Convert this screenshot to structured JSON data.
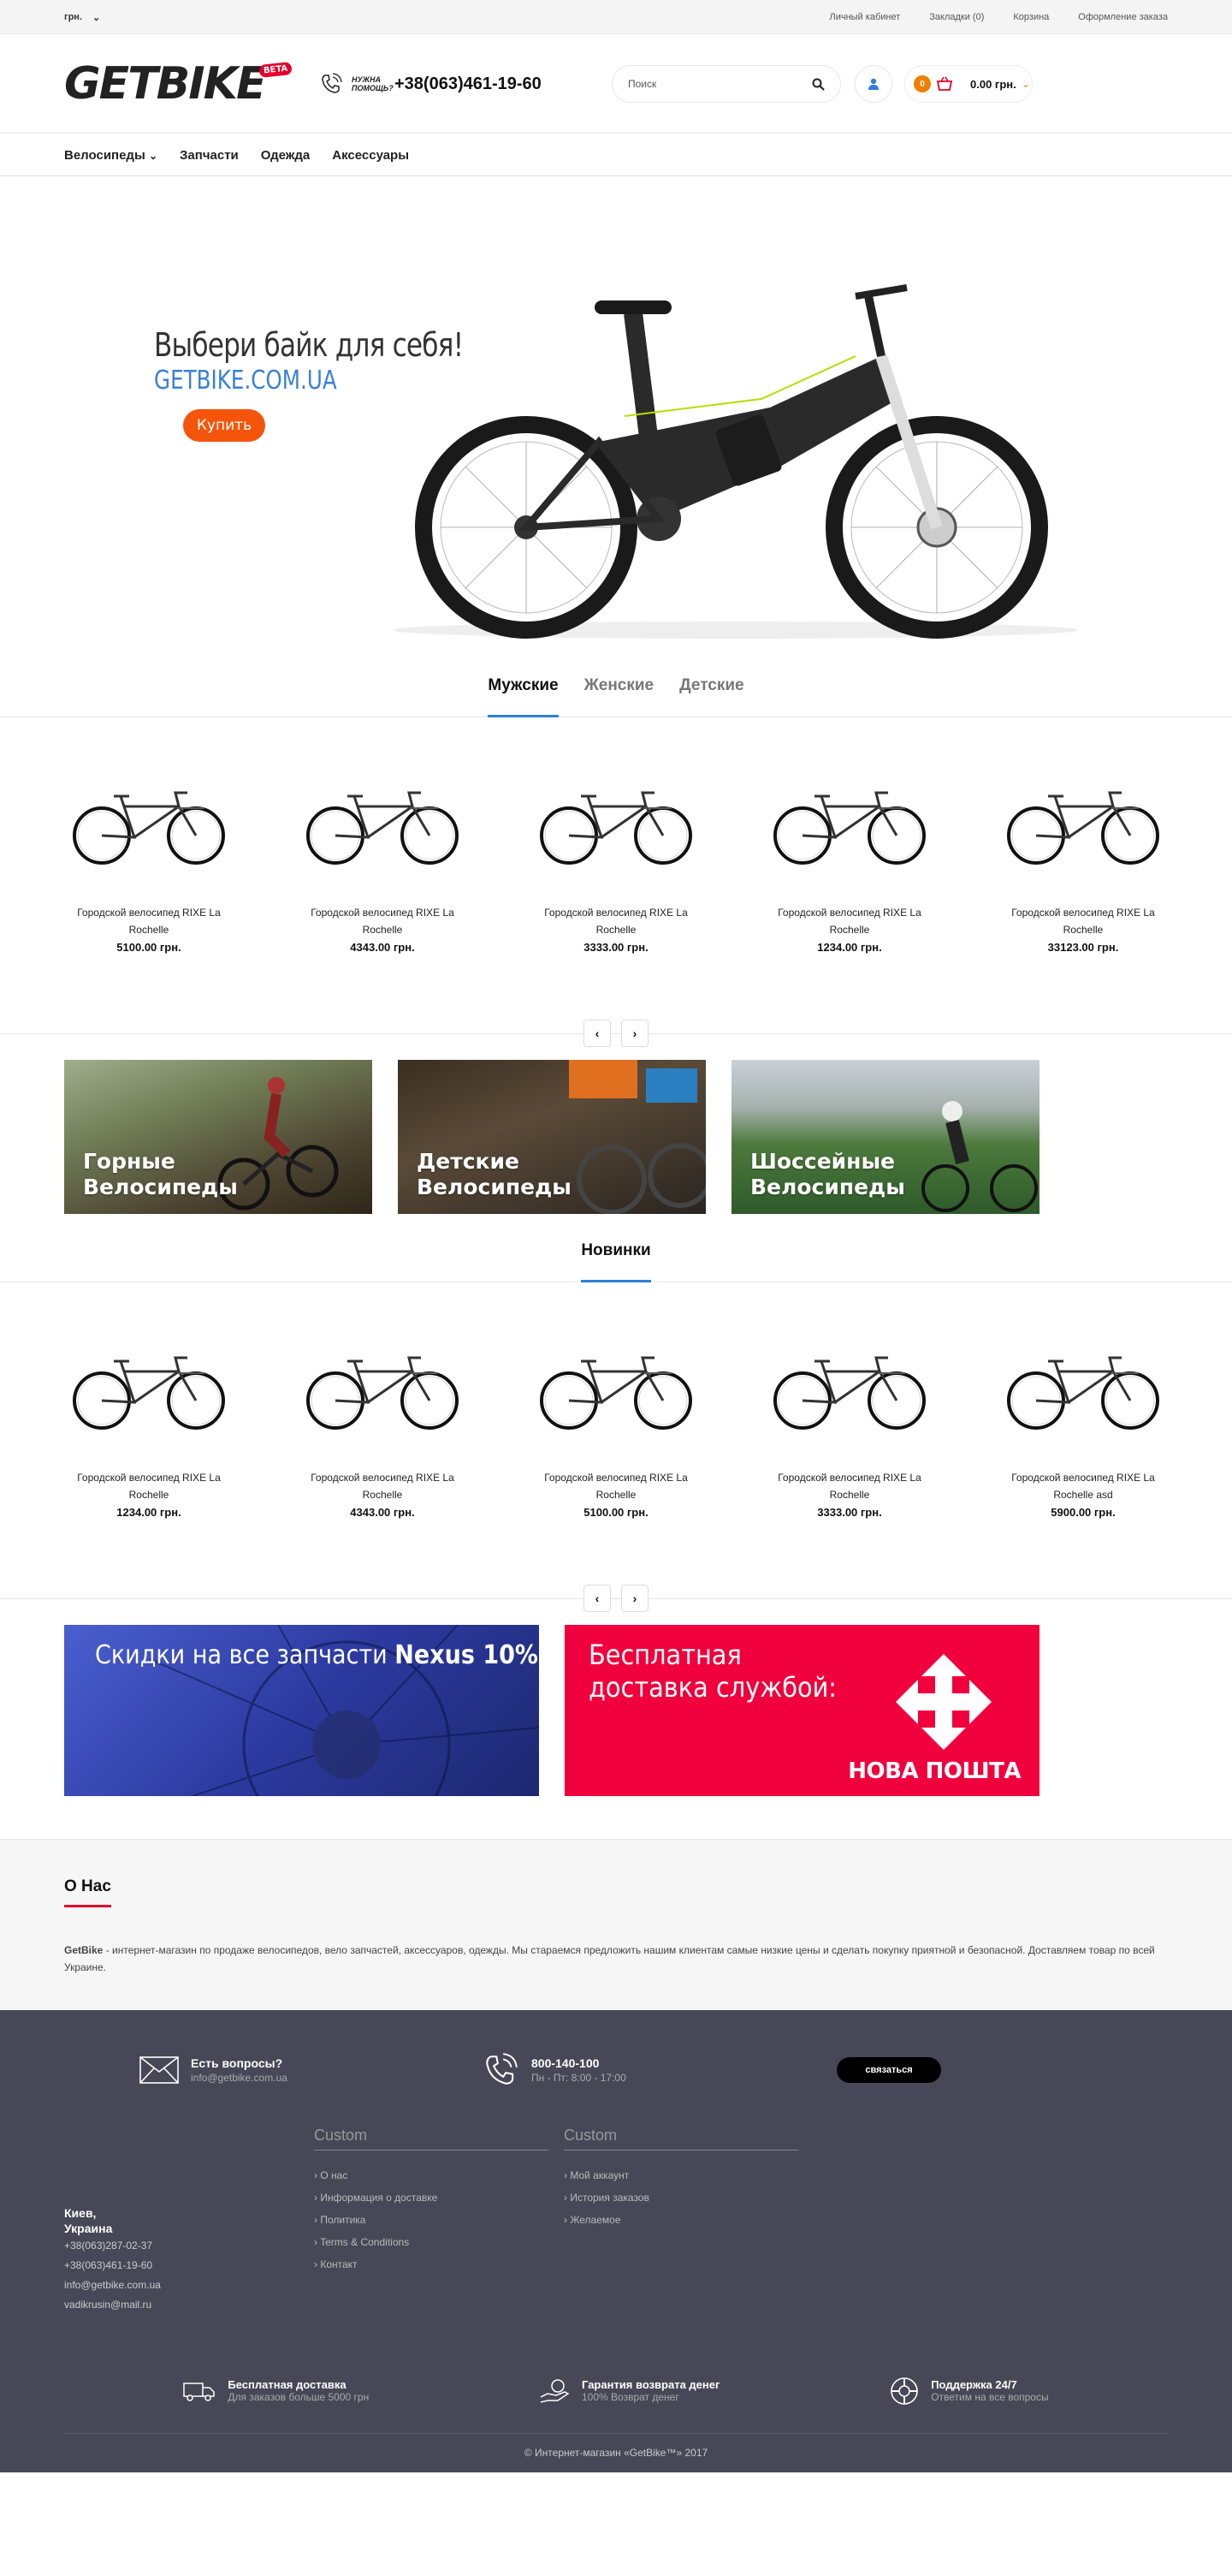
{
  "topbar": {
    "currency": "грн.",
    "links": [
      "Личный кабинет",
      "Закладки (0)",
      "Корзина",
      "Оформление заказа"
    ]
  },
  "header": {
    "logo": "GETBIKE",
    "beta": "BETA",
    "help_label": "НУЖНА ПОМОЩЬ?",
    "phone": "+38(063)461-19-60",
    "search_placeholder": "Поиск",
    "cart_count": "0",
    "cart_total": "0.00 грн."
  },
  "nav": [
    "Велосипеды",
    "Запчасти",
    "Одежда",
    "Аксессуары"
  ],
  "hero": {
    "title": "Выбери байк для себя!",
    "subtitle": "GETBIKE.COM.UA",
    "button": "Купить"
  },
  "tabs": [
    "Мужские",
    "Женские",
    "Детские"
  ],
  "products1": [
    {
      "name": "Городской велосипед RIXE La Rochelle",
      "price": "5100.00 грн."
    },
    {
      "name": "Городской велосипед RIXE La Rochelle",
      "price": "4343.00 грн."
    },
    {
      "name": "Городской велосипед RIXE La Rochelle",
      "price": "3333.00 грн."
    },
    {
      "name": "Городской велосипед RIXE La Rochelle",
      "price": "1234.00 грн."
    },
    {
      "name": "Городской велосипед RIXE La Rochelle",
      "price": "33123.00 грн."
    }
  ],
  "categories": [
    "Горные Велосипеды",
    "Детские Велосипеды",
    "Шоссейные Велосипеды"
  ],
  "new_title": "Новинки",
  "products2": [
    {
      "name": "Городской велосипед RIXE La Rochelle",
      "price": "1234.00 грн."
    },
    {
      "name": "Городской велосипед RIXE La Rochelle",
      "price": "4343.00 грн."
    },
    {
      "name": "Городской велосипед RIXE La Rochelle",
      "price": "5100.00 грн."
    },
    {
      "name": "Городской велосипед RIXE La Rochelle",
      "price": "3333.00 грн."
    },
    {
      "name": "Городской велосипед RIXE La Rochelle asd",
      "price": "5900.00 грн."
    }
  ],
  "promo1": {
    "text": "Скидки на все запчасти",
    "brand": "Nexus 10%"
  },
  "promo2": {
    "text_line1": "Бесплатная",
    "text_line2": "доставка службой:",
    "logo_text": "НОВА ПОШТА"
  },
  "about": {
    "title": "О Нас",
    "brand": "GetBike",
    "text": " - интернет-магазин по продаже велосипедов, вело запчастей, аксессуаров, одежды. Мы стараемся предложить нашим клиентам самые низкие цены и сделать покупку приятной и безопасной. Доставляем товар по всей Украине."
  },
  "footer": {
    "q_title": "Есть вопросы?",
    "q_email": "info@getbike.com.ua",
    "phone": "800-140-100",
    "hours": "Пн - Пт: 8:00 - 17:00",
    "call_button": "связаться",
    "city": "Киев,",
    "country": "Украина",
    "contacts": [
      "+38(063)287-02-37",
      "+38(063)461-19-60",
      "info@getbike.com.ua",
      "vadikrusin@mail.ru"
    ],
    "col1": {
      "title": "Custom",
      "items": [
        "О нас",
        "Информация о доставке",
        "Политика",
        "Terms & Conditions",
        "Контакт"
      ]
    },
    "col2": {
      "title": "Custom",
      "items": [
        "Мой аккаунт",
        "История заказов",
        "Желаемое"
      ]
    },
    "features": [
      {
        "title": "Бесплатная доставка",
        "sub": "Для заказов больше 5000 грн"
      },
      {
        "title": "Гарантия возврата денег",
        "sub": "100% Возврат денег"
      },
      {
        "title": "Поддержка 24/7",
        "sub": "Ответим на все вопросы"
      }
    ],
    "copyright": "© Интернет-магазин «GetBike™» 2017"
  },
  "colors": {
    "accent": "#2d7fd8",
    "buy": "#f5550b",
    "red": "#e4002b",
    "footer_bg": "#474757"
  }
}
